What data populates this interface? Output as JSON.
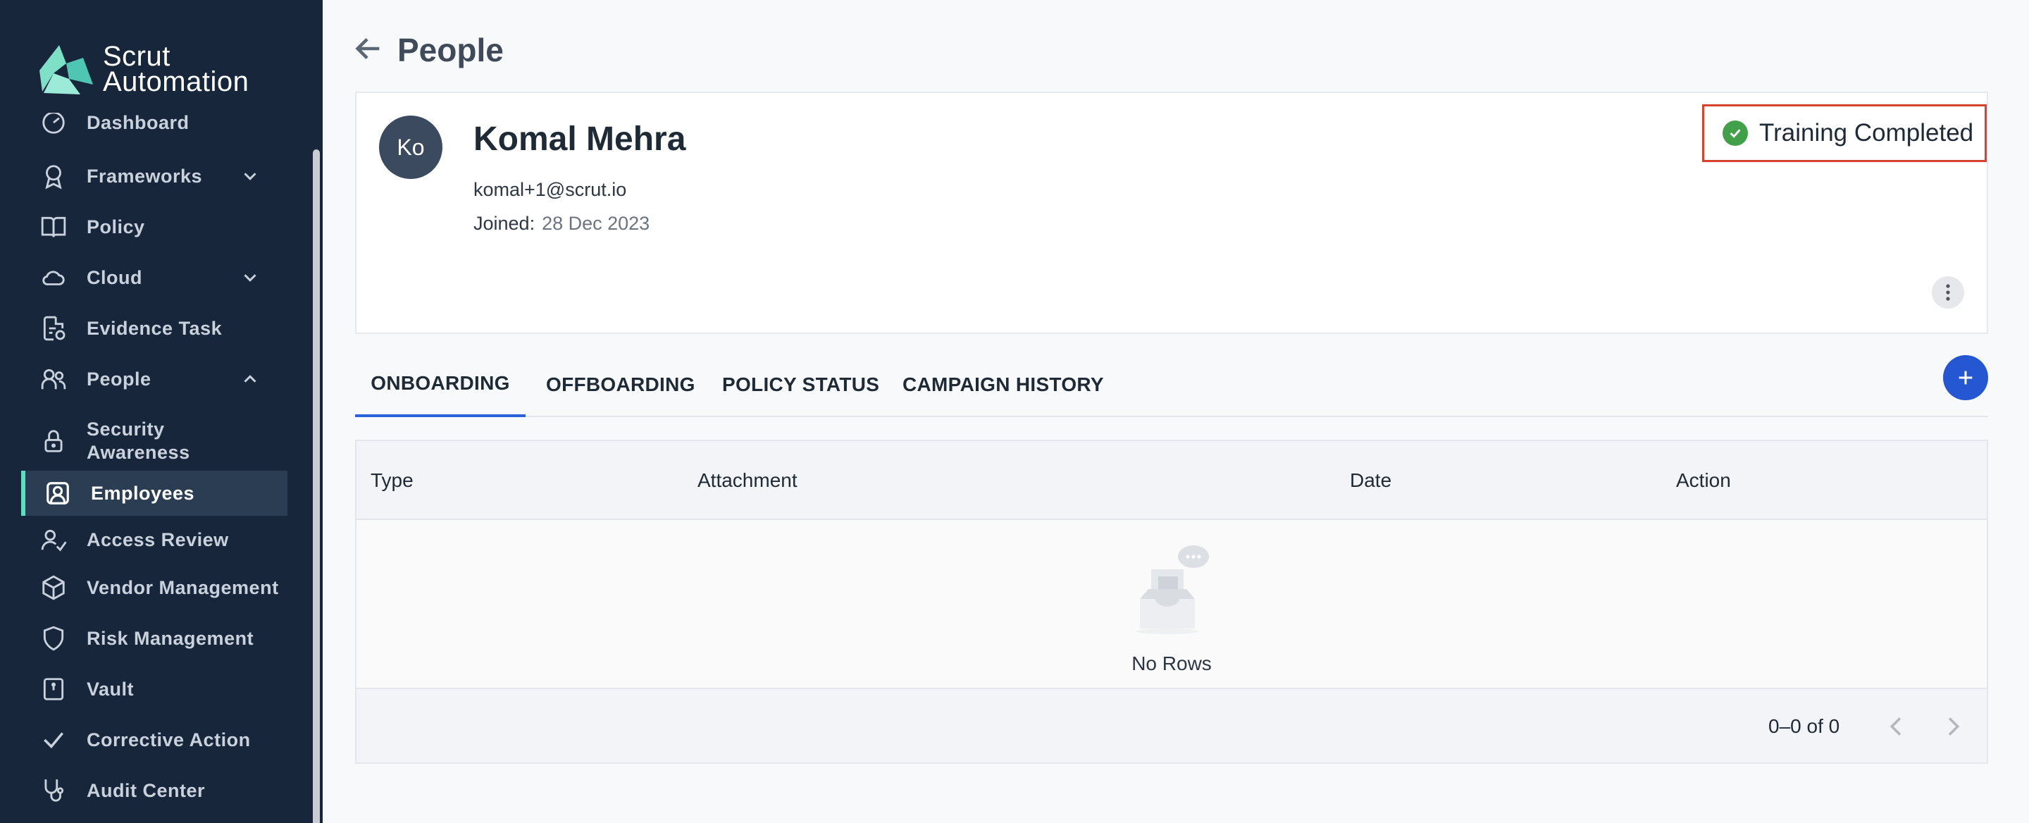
{
  "app": {
    "logo_line1": "Scrut",
    "logo_line2": "Automation"
  },
  "sidebar": {
    "items": [
      {
        "label": "Dashboard",
        "icon": "dashboard-icon"
      },
      {
        "label": "Frameworks",
        "icon": "award-icon",
        "expandable": true
      },
      {
        "label": "Policy",
        "icon": "book-icon"
      },
      {
        "label": "Cloud",
        "icon": "cloud-icon",
        "expandable": true
      },
      {
        "label": "Evidence Task",
        "icon": "file-check-icon"
      },
      {
        "label": "People",
        "icon": "users-icon",
        "expanded": true
      },
      {
        "label": "Security Awareness",
        "icon": "lock-icon",
        "line1": "Security",
        "line2": "Awareness"
      },
      {
        "label": "Employees",
        "icon": "user-square-icon",
        "active": true
      },
      {
        "label": "Access Review",
        "icon": "user-check-icon"
      },
      {
        "label": "Vendor Management",
        "icon": "box-icon"
      },
      {
        "label": "Risk Management",
        "icon": "shield-icon"
      },
      {
        "label": "Vault",
        "icon": "vault-icon"
      },
      {
        "label": "Corrective Action",
        "icon": "check-icon"
      },
      {
        "label": "Audit Center",
        "icon": "stethoscope-icon"
      }
    ]
  },
  "header": {
    "title": "People"
  },
  "employee": {
    "initials": "Ko",
    "name": "Komal Mehra",
    "email": "komal+1@scrut.io",
    "joined_label": "Joined:",
    "joined_date": "28 Dec 2023",
    "status": "Training Completed",
    "status_color": "#43a04a"
  },
  "tabs": [
    {
      "label": "ONBOARDING",
      "active": true
    },
    {
      "label": "OFFBOARDING"
    },
    {
      "label": "POLICY STATUS"
    },
    {
      "label": "CAMPAIGN HISTORY"
    }
  ],
  "table": {
    "columns": [
      "Type",
      "Attachment",
      "Date",
      "Action"
    ],
    "rows": [],
    "empty_text": "No Rows",
    "pagination": "0–0 of 0"
  },
  "colors": {
    "sidebar_bg": "#17263a",
    "accent": "#5ee0c0",
    "primary": "#2457d1",
    "highlight_border": "#d9412f"
  }
}
